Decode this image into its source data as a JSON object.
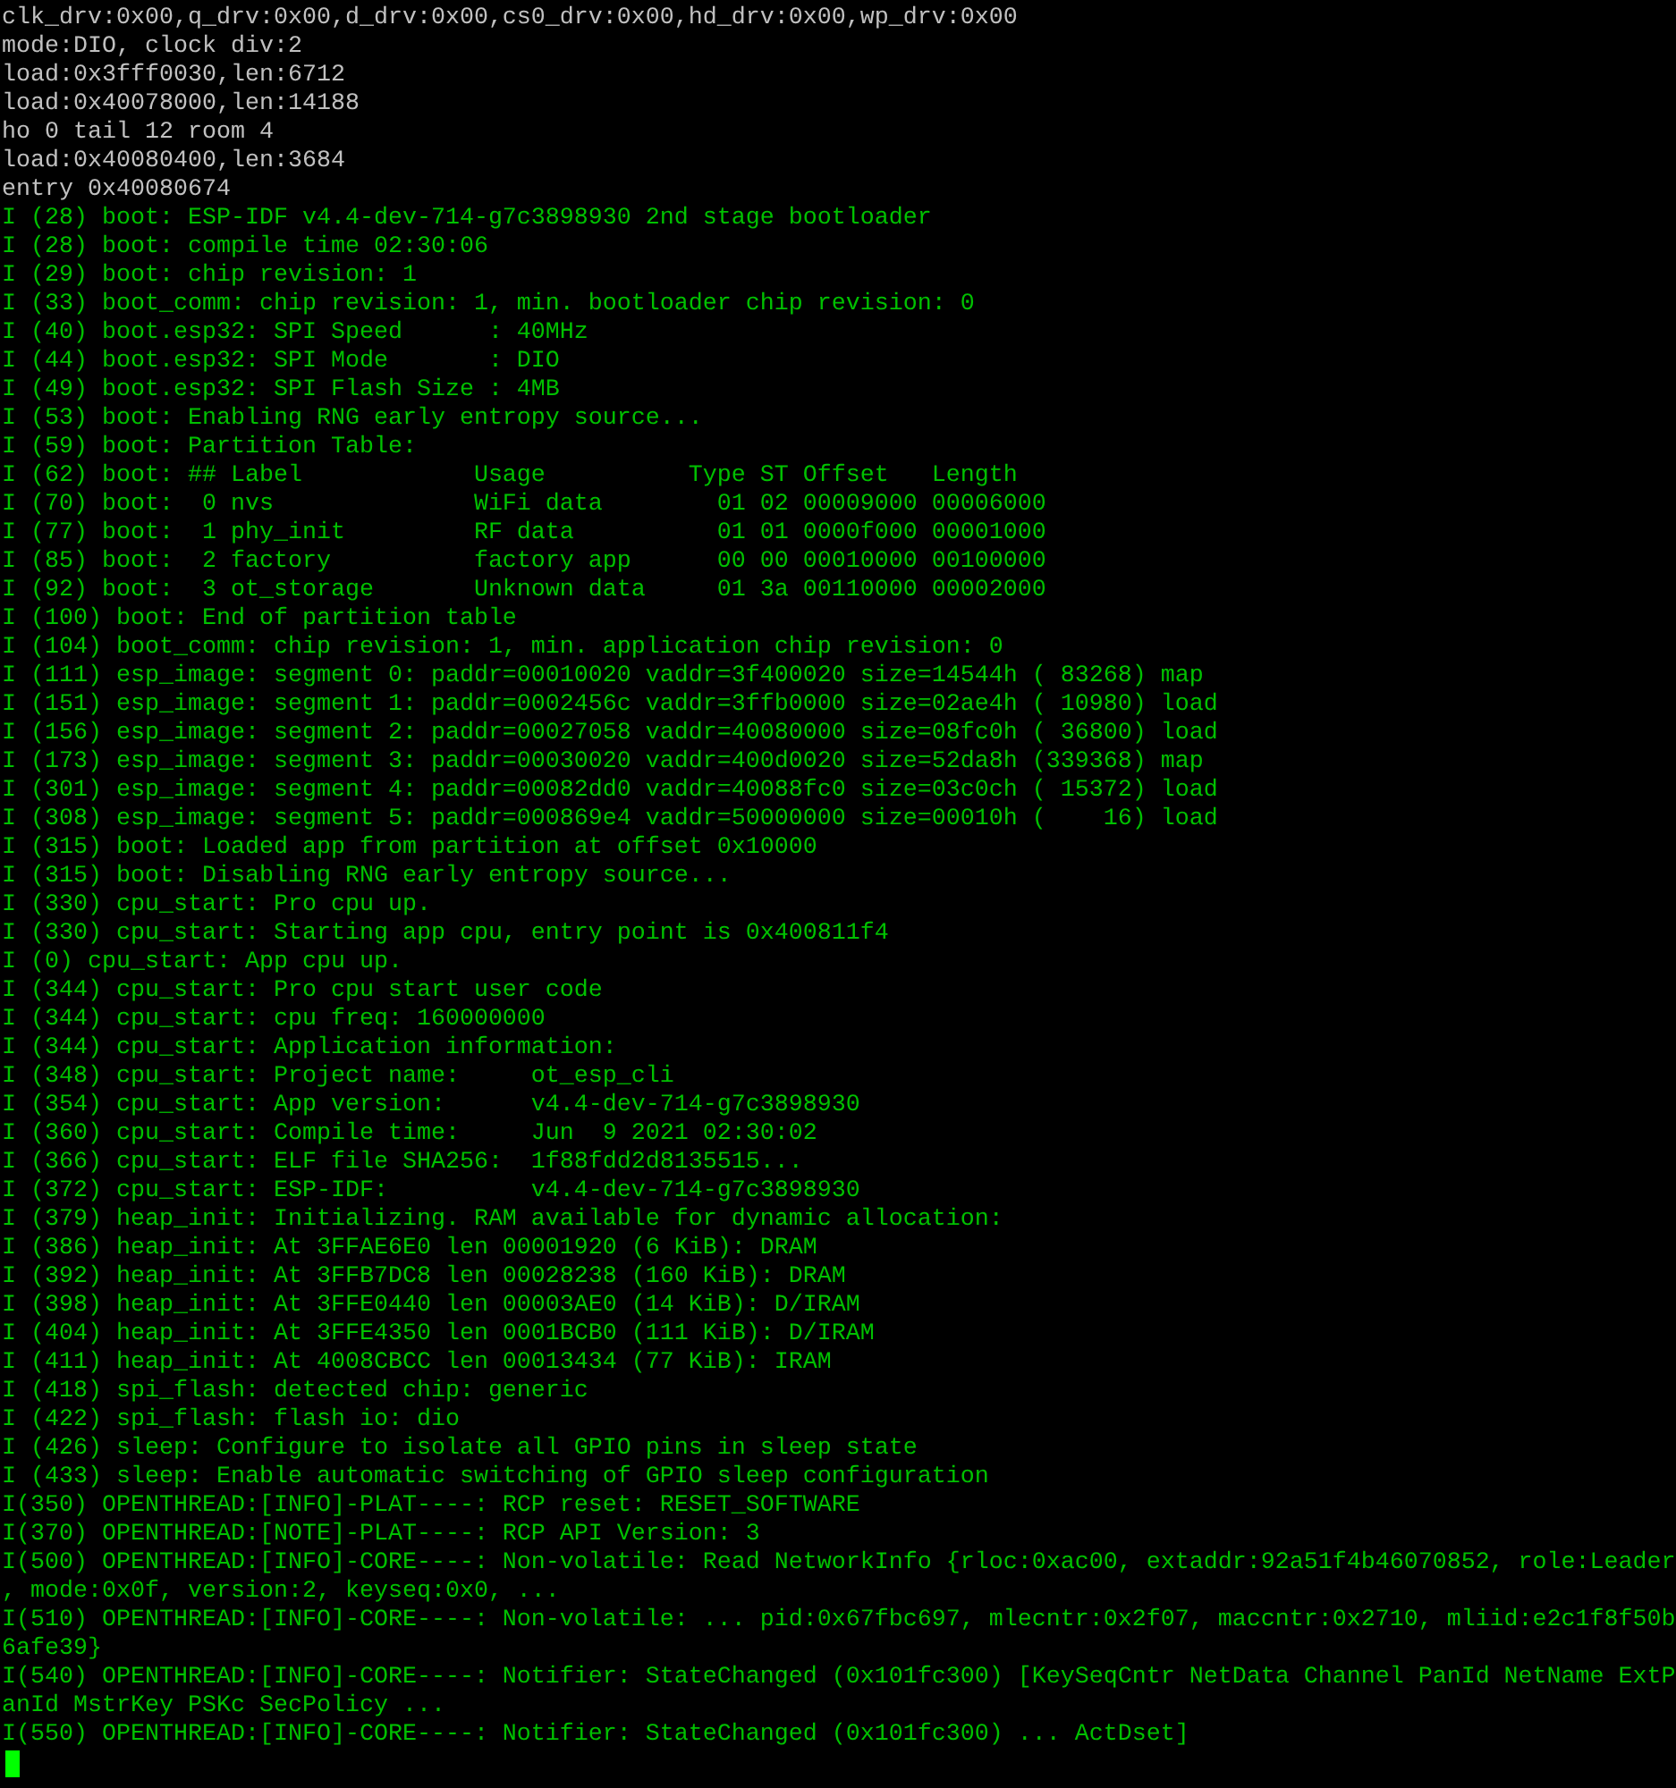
{
  "terminal": {
    "lines": [
      {
        "kind": "plain",
        "text": "clk_drv:0x00,q_drv:0x00,d_drv:0x00,cs0_drv:0x00,hd_drv:0x00,wp_drv:0x00"
      },
      {
        "kind": "plain",
        "text": "mode:DIO, clock div:2"
      },
      {
        "kind": "plain",
        "text": "load:0x3fff0030,len:6712"
      },
      {
        "kind": "plain",
        "text": "load:0x40078000,len:14188"
      },
      {
        "kind": "plain",
        "text": "ho 0 tail 12 room 4"
      },
      {
        "kind": "plain",
        "text": "load:0x40080400,len:3684"
      },
      {
        "kind": "plain",
        "text": "entry 0x40080674"
      },
      {
        "kind": "log",
        "text": "I (28) boot: ESP-IDF v4.4-dev-714-g7c3898930 2nd stage bootloader"
      },
      {
        "kind": "log",
        "text": "I (28) boot: compile time 02:30:06"
      },
      {
        "kind": "log",
        "text": "I (29) boot: chip revision: 1"
      },
      {
        "kind": "log",
        "text": "I (33) boot_comm: chip revision: 1, min. bootloader chip revision: 0"
      },
      {
        "kind": "log",
        "text": "I (40) boot.esp32: SPI Speed      : 40MHz"
      },
      {
        "kind": "log",
        "text": "I (44) boot.esp32: SPI Mode       : DIO"
      },
      {
        "kind": "log",
        "text": "I (49) boot.esp32: SPI Flash Size : 4MB"
      },
      {
        "kind": "log",
        "text": "I (53) boot: Enabling RNG early entropy source..."
      },
      {
        "kind": "log",
        "text": "I (59) boot: Partition Table:"
      },
      {
        "kind": "log",
        "text": "I (62) boot: ## Label            Usage          Type ST Offset   Length"
      },
      {
        "kind": "log",
        "text": "I (70) boot:  0 nvs              WiFi data        01 02 00009000 00006000"
      },
      {
        "kind": "log",
        "text": "I (77) boot:  1 phy_init         RF data          01 01 0000f000 00001000"
      },
      {
        "kind": "log",
        "text": "I (85) boot:  2 factory          factory app      00 00 00010000 00100000"
      },
      {
        "kind": "log",
        "text": "I (92) boot:  3 ot_storage       Unknown data     01 3a 00110000 00002000"
      },
      {
        "kind": "log",
        "text": "I (100) boot: End of partition table"
      },
      {
        "kind": "log",
        "text": "I (104) boot_comm: chip revision: 1, min. application chip revision: 0"
      },
      {
        "kind": "log",
        "text": "I (111) esp_image: segment 0: paddr=00010020 vaddr=3f400020 size=14544h ( 83268) map"
      },
      {
        "kind": "log",
        "text": "I (151) esp_image: segment 1: paddr=0002456c vaddr=3ffb0000 size=02ae4h ( 10980) load"
      },
      {
        "kind": "log",
        "text": "I (156) esp_image: segment 2: paddr=00027058 vaddr=40080000 size=08fc0h ( 36800) load"
      },
      {
        "kind": "log",
        "text": "I (173) esp_image: segment 3: paddr=00030020 vaddr=400d0020 size=52da8h (339368) map"
      },
      {
        "kind": "log",
        "text": "I (301) esp_image: segment 4: paddr=00082dd0 vaddr=40088fc0 size=03c0ch ( 15372) load"
      },
      {
        "kind": "log",
        "text": "I (308) esp_image: segment 5: paddr=000869e4 vaddr=50000000 size=00010h (    16) load"
      },
      {
        "kind": "log",
        "text": "I (315) boot: Loaded app from partition at offset 0x10000"
      },
      {
        "kind": "log",
        "text": "I (315) boot: Disabling RNG early entropy source..."
      },
      {
        "kind": "log",
        "text": "I (330) cpu_start: Pro cpu up."
      },
      {
        "kind": "log",
        "text": "I (330) cpu_start: Starting app cpu, entry point is 0x400811f4"
      },
      {
        "kind": "log",
        "text": "I (0) cpu_start: App cpu up."
      },
      {
        "kind": "log",
        "text": "I (344) cpu_start: Pro cpu start user code"
      },
      {
        "kind": "log",
        "text": "I (344) cpu_start: cpu freq: 160000000"
      },
      {
        "kind": "log",
        "text": "I (344) cpu_start: Application information:"
      },
      {
        "kind": "log",
        "text": "I (348) cpu_start: Project name:     ot_esp_cli"
      },
      {
        "kind": "log",
        "text": "I (354) cpu_start: App version:      v4.4-dev-714-g7c3898930"
      },
      {
        "kind": "log",
        "text": "I (360) cpu_start: Compile time:     Jun  9 2021 02:30:02"
      },
      {
        "kind": "log",
        "text": "I (366) cpu_start: ELF file SHA256:  1f88fdd2d8135515..."
      },
      {
        "kind": "log",
        "text": "I (372) cpu_start: ESP-IDF:          v4.4-dev-714-g7c3898930"
      },
      {
        "kind": "log",
        "text": "I (379) heap_init: Initializing. RAM available for dynamic allocation:"
      },
      {
        "kind": "log",
        "text": "I (386) heap_init: At 3FFAE6E0 len 00001920 (6 KiB): DRAM"
      },
      {
        "kind": "log",
        "text": "I (392) heap_init: At 3FFB7DC8 len 00028238 (160 KiB): DRAM"
      },
      {
        "kind": "log",
        "text": "I (398) heap_init: At 3FFE0440 len 00003AE0 (14 KiB): D/IRAM"
      },
      {
        "kind": "log",
        "text": "I (404) heap_init: At 3FFE4350 len 0001BCB0 (111 KiB): D/IRAM"
      },
      {
        "kind": "log",
        "text": "I (411) heap_init: At 4008CBCC len 00013434 (77 KiB): IRAM"
      },
      {
        "kind": "log",
        "text": "I (418) spi_flash: detected chip: generic"
      },
      {
        "kind": "log",
        "text": "I (422) spi_flash: flash io: dio"
      },
      {
        "kind": "log",
        "text": "I (426) sleep: Configure to isolate all GPIO pins in sleep state"
      },
      {
        "kind": "log",
        "text": "I (433) sleep: Enable automatic switching of GPIO sleep configuration"
      },
      {
        "kind": "log",
        "text": "I(350) OPENTHREAD:[INFO]-PLAT----: RCP reset: RESET_SOFTWARE"
      },
      {
        "kind": "log",
        "text": "I(370) OPENTHREAD:[NOTE]-PLAT----: RCP API Version: 3"
      },
      {
        "kind": "log",
        "text": "I(500) OPENTHREAD:[INFO]-CORE----: Non-volatile: Read NetworkInfo {rloc:0xac00, extaddr:92a51f4b46070852, role:Leader"
      },
      {
        "kind": "log",
        "text": ", mode:0x0f, version:2, keyseq:0x0, ..."
      },
      {
        "kind": "log",
        "text": "I(510) OPENTHREAD:[INFO]-CORE----: Non-volatile: ... pid:0x67fbc697, mlecntr:0x2f07, maccntr:0x2710, mliid:e2c1f8f50b"
      },
      {
        "kind": "log",
        "text": "6afe39}"
      },
      {
        "kind": "log",
        "text": "I(540) OPENTHREAD:[INFO]-CORE----: Notifier: StateChanged (0x101fc300) [KeySeqCntr NetData Channel PanId NetName ExtP"
      },
      {
        "kind": "log",
        "text": "anId MstrKey PSKc SecPolicy ..."
      },
      {
        "kind": "log",
        "text": "I(550) OPENTHREAD:[INFO]-CORE----: Notifier: StateChanged (0x101fc300) ... ActDset]"
      }
    ]
  }
}
